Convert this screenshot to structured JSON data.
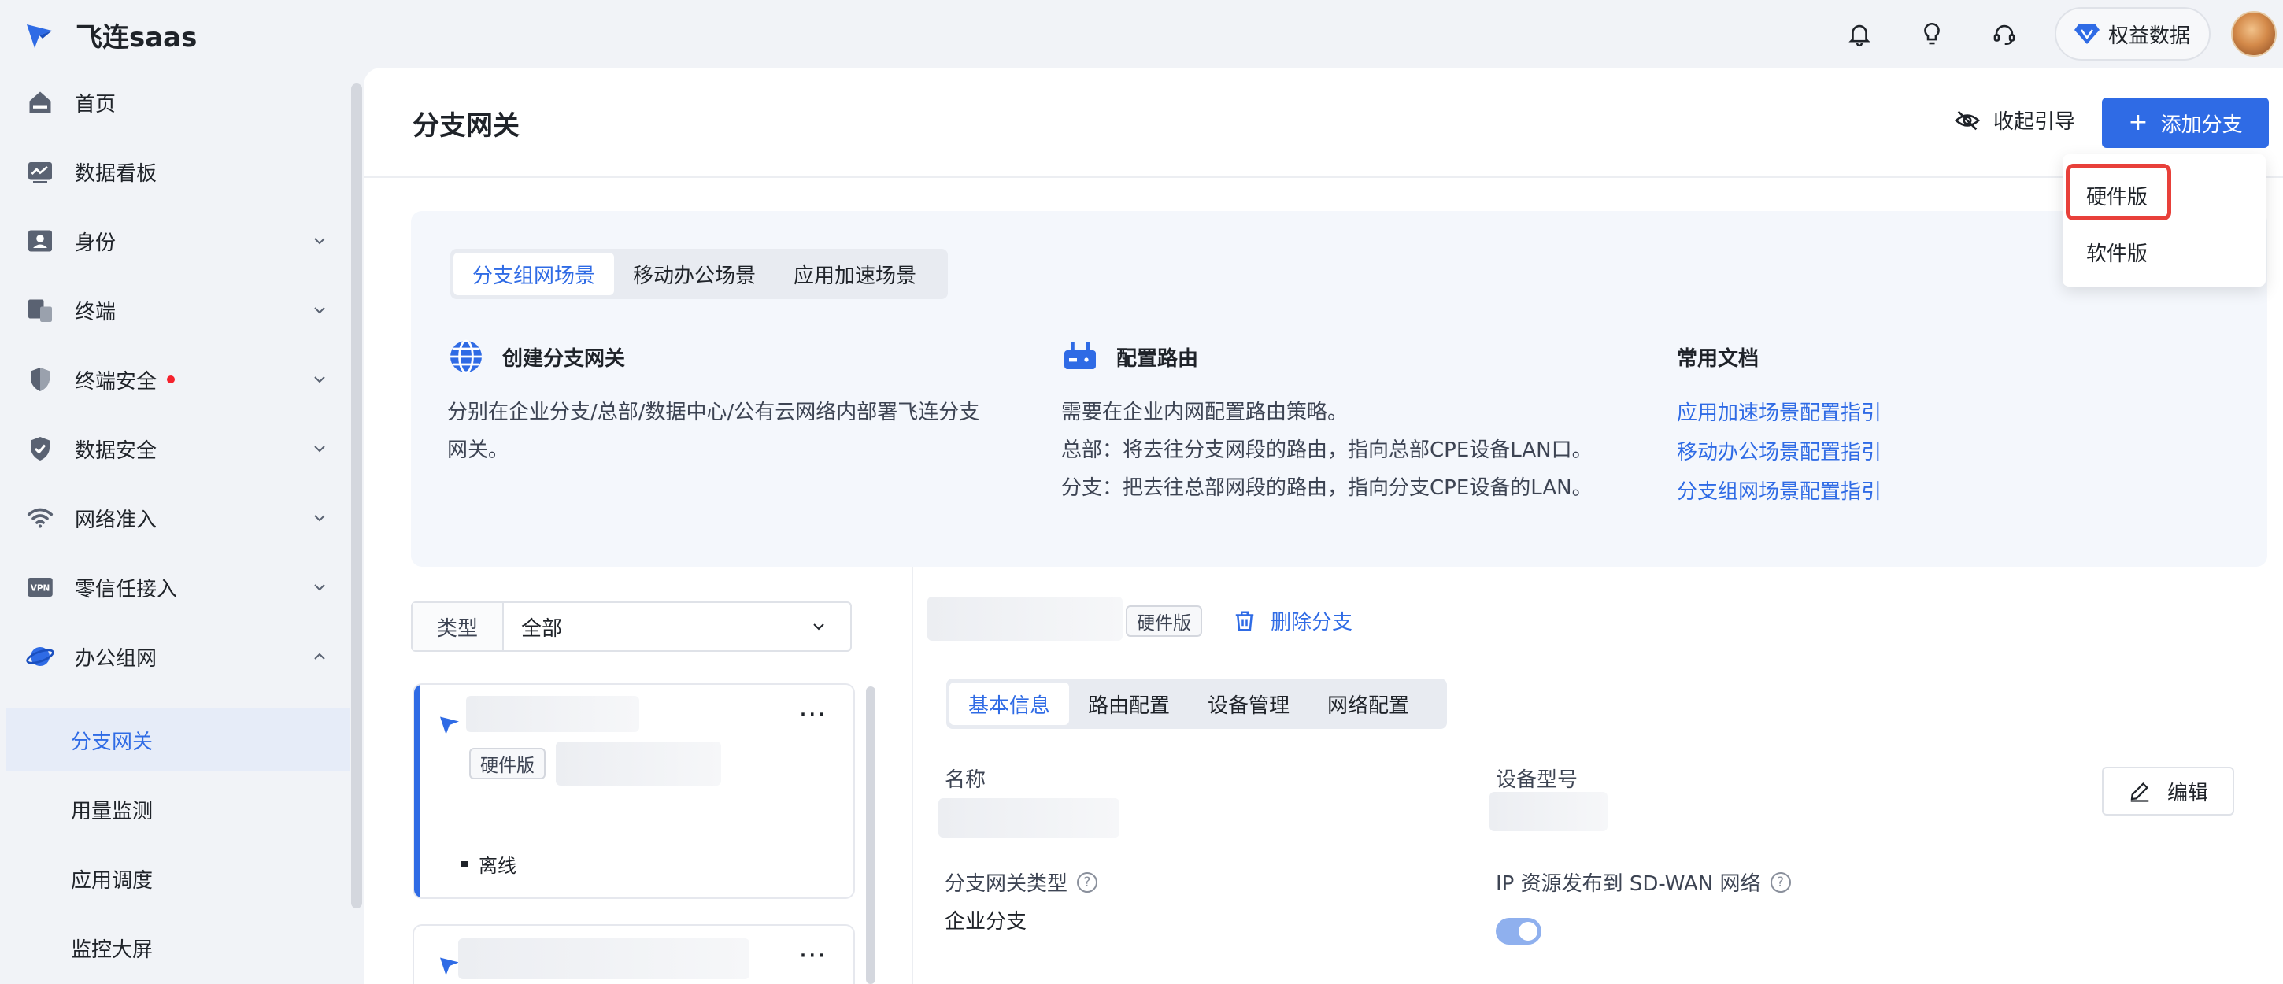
{
  "app": {
    "name": "飞连saas"
  },
  "topbar": {
    "rights_label": "权益数据"
  },
  "sidebar": {
    "items": [
      {
        "label": "首页"
      },
      {
        "label": "数据看板"
      },
      {
        "label": "身份"
      },
      {
        "label": "终端"
      },
      {
        "label": "终端安全"
      },
      {
        "label": "数据安全"
      },
      {
        "label": "网络准入"
      },
      {
        "label": "零信任接入"
      },
      {
        "label": "办公组网"
      }
    ],
    "sub_items": [
      {
        "label": "分支网关"
      },
      {
        "label": "用量监测"
      },
      {
        "label": "应用调度"
      },
      {
        "label": "监控大屏"
      }
    ]
  },
  "header": {
    "title": "分支网关",
    "collapse_label": "收起引导",
    "add_label": "添加分支"
  },
  "dropdown": {
    "options": [
      "硬件版",
      "软件版"
    ]
  },
  "guide": {
    "tabs": [
      "分支组网场景",
      "移动办公场景",
      "应用加速场景"
    ],
    "col1": {
      "title": "创建分支网关",
      "lines": [
        "分别在企业分支/总部/数据中心/公有云网络内部署飞连分支",
        "网关。"
      ]
    },
    "col2": {
      "title": "配置路由",
      "lines": [
        "需要在企业内网配置路由策略。",
        "总部：将去往分支网段的路由，指向总部CPE设备LAN口。",
        "分支：把去往总部网段的路由，指向分支CPE设备的LAN。"
      ]
    },
    "col3": {
      "title": "常用文档",
      "links": [
        "应用加速场景配置指引",
        "移动办公场景配置指引",
        "分支组网场景配置指引"
      ]
    }
  },
  "filter": {
    "label": "类型",
    "value": "全部"
  },
  "list": {
    "cards": [
      {
        "tag": "硬件版",
        "status": "离线",
        "more": "···"
      },
      {
        "more": "···"
      }
    ]
  },
  "detail": {
    "tag": "硬件版",
    "delete_label": "删除分支",
    "tabs": [
      "基本信息",
      "路由配置",
      "设备管理",
      "网络配置"
    ],
    "fields": {
      "name_label": "名称",
      "model_label": "设备型号",
      "type_label": "分支网关类型",
      "type_value": "企业分支",
      "ip_label": "IP 资源发布到 SD-WAN 网络",
      "help_glyph": "?"
    },
    "edit_label": "编辑",
    "ip_publish_enabled": true
  },
  "colors": {
    "accent": "#2f6be5",
    "highlight": "#e8403a",
    "badge": "#f5222d"
  }
}
